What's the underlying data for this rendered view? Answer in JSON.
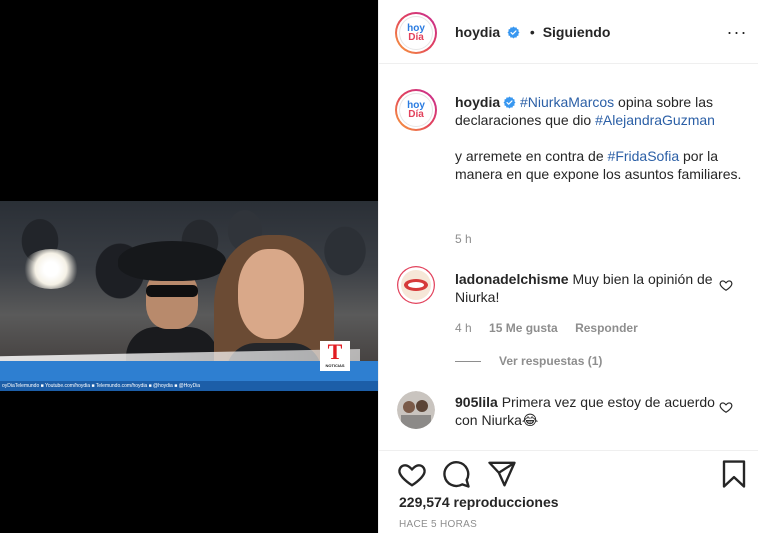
{
  "video": {
    "ticker_text": "oyDiaTelemundo   ■ Youtube.com/hoydia   ■ Telemundo.com/hoydia   ■ @hoydia   ■ @HoyDia",
    "network_logo": "T",
    "network_label": "NOTICIAS"
  },
  "header": {
    "avatar_line1": "hoy",
    "avatar_line2": "Día",
    "username": "hoydia",
    "separator": "•",
    "follow_label": "Siguiendo",
    "more_label": "···"
  },
  "caption": {
    "username": "hoydia",
    "hashtag1": "#NiurkaMarcos",
    "text1": " opina sobre las declaraciones que dio ",
    "hashtag2": "#AlejandraGuzman",
    "text2": "y arremete en contra de ",
    "hashtag3": "#FridaSofia",
    "text3": " por la manera en que expone los asuntos familiares.",
    "time": "5 h"
  },
  "comments": [
    {
      "username": "ladonadelchisme",
      "text": " Muy bien la opinión de Niurka!",
      "time": "4 h",
      "likes": "15 Me gusta",
      "reply_label": "Responder",
      "replies_label": "Ver respuestas (1)"
    },
    {
      "username": "905lila",
      "text": " Primera vez que estoy de acuerdo con Niurka",
      "emoji": "😂"
    }
  ],
  "actions": {
    "views": "229,574 reproducciones",
    "ago": "HACE 5 HORAS"
  },
  "colors": {
    "hashtag": "#2b5fa6",
    "verified": "#3897f0",
    "muted": "#8e8e8e"
  }
}
